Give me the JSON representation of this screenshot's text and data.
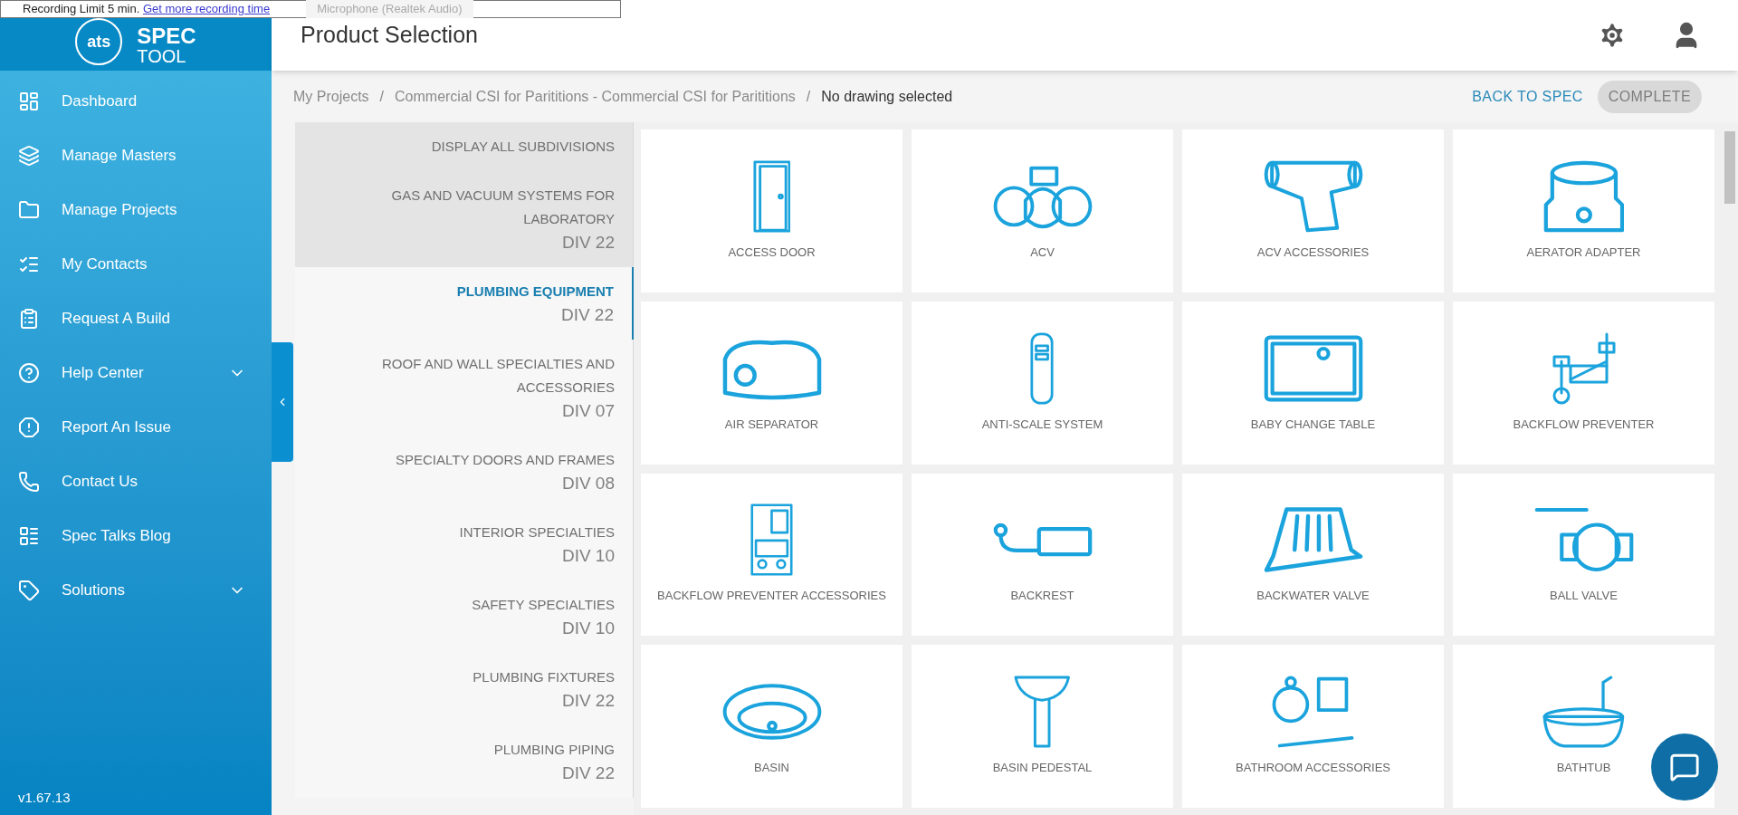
{
  "recorder_popup": {
    "text": "Recording Limit 5 min.",
    "link": "Get more recording time",
    "microphone": "Microphone (Realtek Audio)"
  },
  "logo": {
    "mark": "ats",
    "title": "SPEC",
    "subtitle": "TOOL"
  },
  "header": {
    "title": "Product Selection"
  },
  "sidebar": {
    "items": [
      {
        "label": "Dashboard",
        "expandable": false
      },
      {
        "label": "Manage Masters",
        "expandable": false
      },
      {
        "label": "Manage Projects",
        "expandable": false
      },
      {
        "label": "My Contacts",
        "expandable": false
      },
      {
        "label": "Request A Build",
        "expandable": false
      },
      {
        "label": "Help Center",
        "expandable": true
      },
      {
        "label": "Report An Issue",
        "expandable": false
      },
      {
        "label": "Contact Us",
        "expandable": false
      },
      {
        "label": "Spec Talks Blog",
        "expandable": false
      },
      {
        "label": "Solutions",
        "expandable": true
      }
    ],
    "version": "v1.67.13"
  },
  "breadcrumb": [
    "My Projects",
    "Commercial CSI for Parititions - Commercial CSI for Parititions",
    "No drawing selected"
  ],
  "breadcrumb_separator": "/",
  "actions": {
    "back": "BACK TO SPEC",
    "complete": {
      "label": "COMPLETE",
      "disabled": true
    }
  },
  "categories": [
    {
      "name": "DISPLAY ALL SUBDIVISIONS",
      "selected": false,
      "highlighted": true
    },
    {
      "name": "GAS AND VACUUM SYSTEMS FOR LABORATORY",
      "div": "DIV 22",
      "selected": false,
      "highlighted": true
    },
    {
      "name": "PLUMBING EQUIPMENT",
      "div": "DIV 22",
      "selected": true,
      "highlighted": false
    },
    {
      "name": "ROOF AND WALL SPECIALTIES AND ACCESSORIES",
      "div": "DIV 07",
      "selected": false,
      "highlighted": false
    },
    {
      "name": "SPECIALTY DOORS AND FRAMES",
      "div": "DIV 08",
      "selected": false,
      "highlighted": false
    },
    {
      "name": "INTERIOR SPECIALTIES",
      "div": "DIV 10",
      "selected": false,
      "highlighted": false
    },
    {
      "name": "SAFETY SPECIALTIES",
      "div": "DIV 10",
      "selected": false,
      "highlighted": false
    },
    {
      "name": "PLUMBING FIXTURES",
      "div": "DIV 22",
      "selected": false,
      "highlighted": false
    },
    {
      "name": "PLUMBING PIPING",
      "div": "DIV 22",
      "selected": false,
      "highlighted": false
    }
  ],
  "products": [
    "ACCESS DOOR",
    "ACV",
    "ACV ACCESSORIES",
    "AERATOR ADAPTER",
    "AIR SEPARATOR",
    "ANTI-SCALE SYSTEM",
    "BABY CHANGE TABLE",
    "BACKFLOW PREVENTER",
    "BACKFLOW PREVENTER ACCESSORIES",
    "BACKREST",
    "BACKWATER VALVE",
    "BALL VALVE",
    "BASIN",
    "BASIN PEDESTAL",
    "BATHROOM ACCESSORIES",
    "BATHTUB"
  ]
}
